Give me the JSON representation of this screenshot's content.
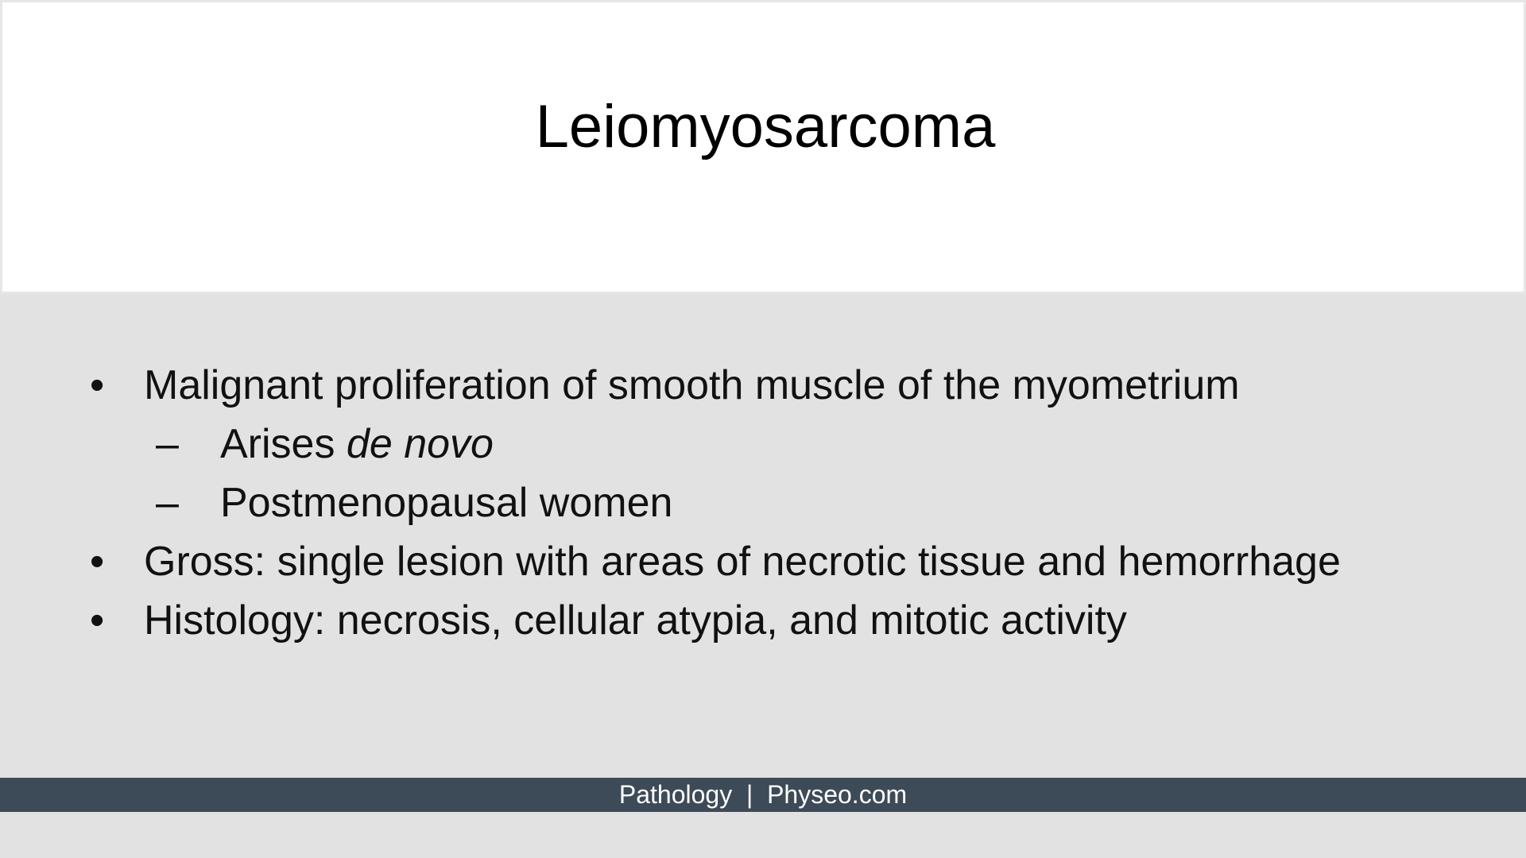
{
  "slide": {
    "title": "Leiomyosarcoma",
    "bullets": [
      {
        "marker": "•",
        "text": "Malignant proliferation of smooth muscle of the myometrium",
        "subitems": [
          {
            "marker": "–",
            "text_plain": "Arises ",
            "text_italic": "de novo"
          },
          {
            "marker": "–",
            "text": "Postmenopausal women"
          }
        ]
      },
      {
        "marker": "•",
        "text": "Gross: single lesion with areas of necrotic tissue and hemorrhage"
      },
      {
        "marker": "•",
        "text": "Histology: necrosis, cellular atypia, and mitotic activity"
      }
    ],
    "footer": {
      "left": "Pathology",
      "separator": "|",
      "right": "Physeo.com"
    }
  },
  "colors": {
    "background": "#e2e2e2",
    "title_box": "#ffffff",
    "footer_bar": "#3d4a57",
    "footer_text": "#ffffff"
  }
}
